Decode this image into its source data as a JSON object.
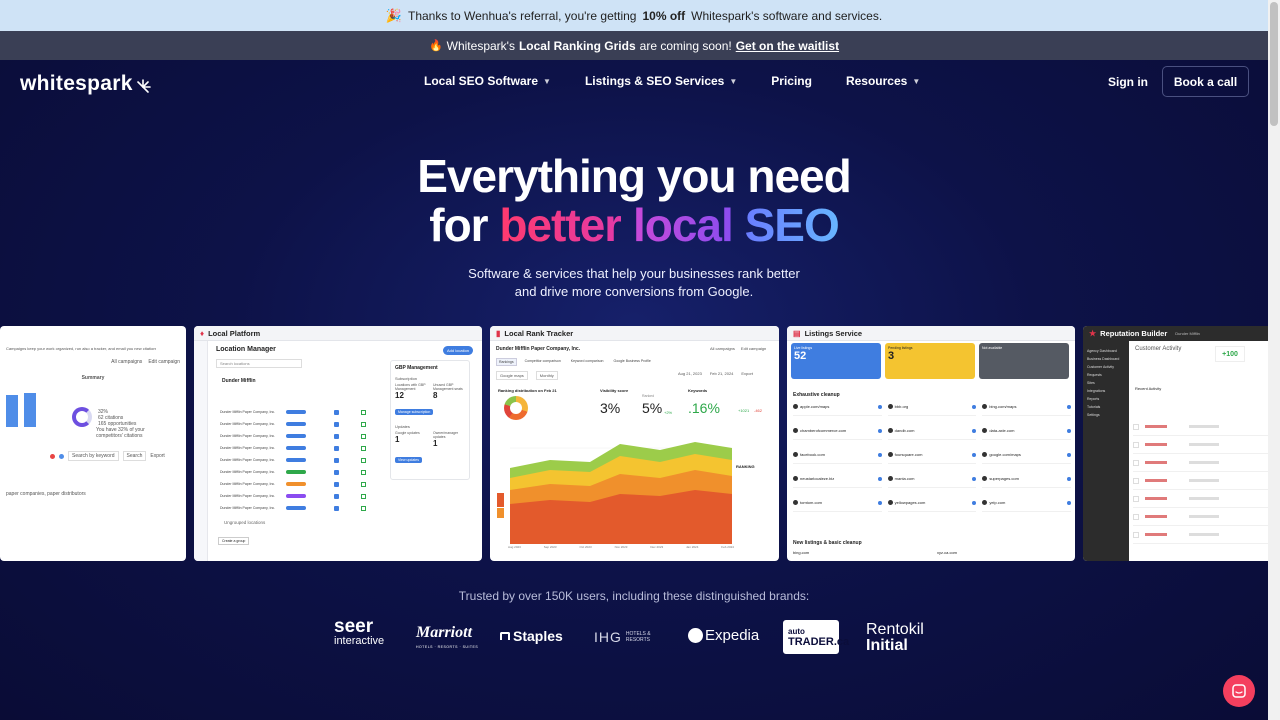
{
  "referral": {
    "icon": "party-popper-icon",
    "prefix": "Thanks to Wenhua's referral, you're getting",
    "discount": "10% off",
    "suffix": "Whitespark's software and services."
  },
  "promo": {
    "icon": "fire-icon",
    "prefix": "Whitespark's",
    "highlight": "Local Ranking Grids",
    "middle": "are coming soon!",
    "link": "Get on the waitlist"
  },
  "nav": {
    "logo": "whitespark",
    "items": [
      {
        "label": "Local SEO Software",
        "has_dropdown": true
      },
      {
        "label": "Listings & SEO Services",
        "has_dropdown": true
      },
      {
        "label": "Pricing",
        "has_dropdown": false
      },
      {
        "label": "Resources",
        "has_dropdown": true
      }
    ],
    "sign_in": "Sign in",
    "book_call": "Book a call"
  },
  "hero": {
    "line1": "Everything you need",
    "line2_prefix": "for",
    "word_better": "better",
    "word_local": "local",
    "word_seo": "SEO",
    "sub_line1": "Software & services that help your businesses rank better",
    "sub_line2": "and drive more conversions from Google."
  },
  "cards": {
    "first": {
      "top_text": "Campaigns keep your work organized, run also a tracker, and email you new citations and reports to them",
      "filter_a": "All campaigns",
      "filter_b": "Edit campaign",
      "summary": "Summary",
      "pct": "32%",
      "stat1": "62 citations",
      "stat2": "165 opportunities",
      "note1": "You have 32% of your",
      "note2": "competitors' citations",
      "search": "Search by keyword",
      "search2": "Search",
      "export": "Export",
      "foot": "paper companies, paper distributors"
    },
    "local_platform": {
      "title": "Local Platform",
      "heading": "Location Manager",
      "add_btn": "Add location",
      "search": "Search locations",
      "group": "Dunder Mifflin",
      "row_label": "Dunder Mifflin Paper Company, Inc.",
      "row_count": 9,
      "gbp_title": "GBP Management",
      "subscriptions": "Subscription",
      "locations_label": "Locations with GBP Management",
      "locations_val": "12",
      "unused_label": "Unused GBP Management seats",
      "unused_val": "8",
      "manage_btn": "Manage subscription",
      "updates": "Updates",
      "google_label": "Google updates",
      "google_val": "1",
      "owner_label": "Owner/manager updates",
      "owner_val": "1",
      "view_btn": "View updates",
      "ungrouped": "Ungrouped locations",
      "create_btn": "Create a group"
    },
    "rank_tracker": {
      "title": "Local Rank Tracker",
      "company": "Dunder Mifflin Paper Company, Inc.",
      "filter_a": "All campaigns",
      "filter_b": "Edit campaign",
      "tabs": [
        "Rankings",
        "Competitor comparison",
        "Keyword comparison",
        "Google Business Profile"
      ],
      "sel_a": "Google maps",
      "sel_b": "Monthly",
      "date_from": "Aug 21, 2023",
      "date_to": "Feb 21, 2024",
      "export": "Export",
      "dist_label": "Ranking distribution on Feb 21",
      "vis_label": "Visibility score",
      "vis_val": "3%",
      "ranked_label": "Ranked",
      "ranked_val": "5%",
      "ranked_delta": "+2%",
      "keywords_label": "Keywords",
      "keywords_val": ".16%",
      "stat_up": "+1021",
      "stat_down": "-462",
      "legend_title": "RANKING",
      "x_labels": [
        "Aug 2023",
        "Sep 2023",
        "Oct 2023",
        "Nov 2023",
        "Dec 2023",
        "Jan 2024",
        "Feb 2024"
      ]
    },
    "listings": {
      "title": "Listings Service",
      "stat1_val": "52",
      "stat2_val": "3",
      "stat1_label": "Live listings",
      "stat2_label": "Pending listings",
      "stat3_label": "Not available",
      "section1": "Exhaustive cleanup",
      "sites": [
        "apple.com/maps",
        "bbb.org",
        "bing.com/maps",
        "chamberofcommerce.com",
        "dandb.com",
        "data-axle.com",
        "facebook.com",
        "foursquare.com",
        "google.com/maps",
        "neustarlocaleze.biz",
        "manta.com",
        "superpages.com",
        "tomtom.com",
        "yellowpages.com",
        "yelp.com"
      ],
      "section2": "New listings & basic cleanup",
      "site_a": "bing.com",
      "site_b": "xyz.ca.com"
    },
    "reputation": {
      "title": "Reputation Builder",
      "company": "Dunder Mifflin",
      "heading": "Customer Activity",
      "sidebar": [
        "Agency Dashboard",
        "Business Dashboard",
        "Customer Activity",
        "Requests",
        "Sites",
        "Integrations",
        "Reports",
        "Tutorials",
        "Settings"
      ],
      "recent": "Recent Activity",
      "score": "+100"
    }
  },
  "trusted": {
    "text": "Trusted by over 150K users, including these distinguished brands:",
    "brands": [
      {
        "name": "seer interactive",
        "line1": "seer",
        "line2": "interactive"
      },
      {
        "name": "Marriott",
        "line1": "Marriott",
        "line2": "HOTELS · RESORTS · SUITES"
      },
      {
        "name": "Staples",
        "line1": "Staples"
      },
      {
        "name": "IHG Hotels & Resorts",
        "line1": "IHG",
        "line2": "HOTELS & RESORTS"
      },
      {
        "name": "Expedia",
        "line1": "Expedia"
      },
      {
        "name": "autoTRADER.ca",
        "line1": "auto",
        "line2": "TRADER.ca"
      },
      {
        "name": "Rentokil Initial",
        "line1": "Rentokil",
        "line2": "Initial"
      }
    ]
  },
  "colors": {
    "hero_bg": "#0b0d3a",
    "referral_bg": "#cfe3f6",
    "promo_bg": "#3a3f55",
    "accent_pink": "#ff3a6e",
    "accent_purple": "#c94ad8",
    "accent_blue": "#6a7cff",
    "chat": "#f43f5e"
  }
}
